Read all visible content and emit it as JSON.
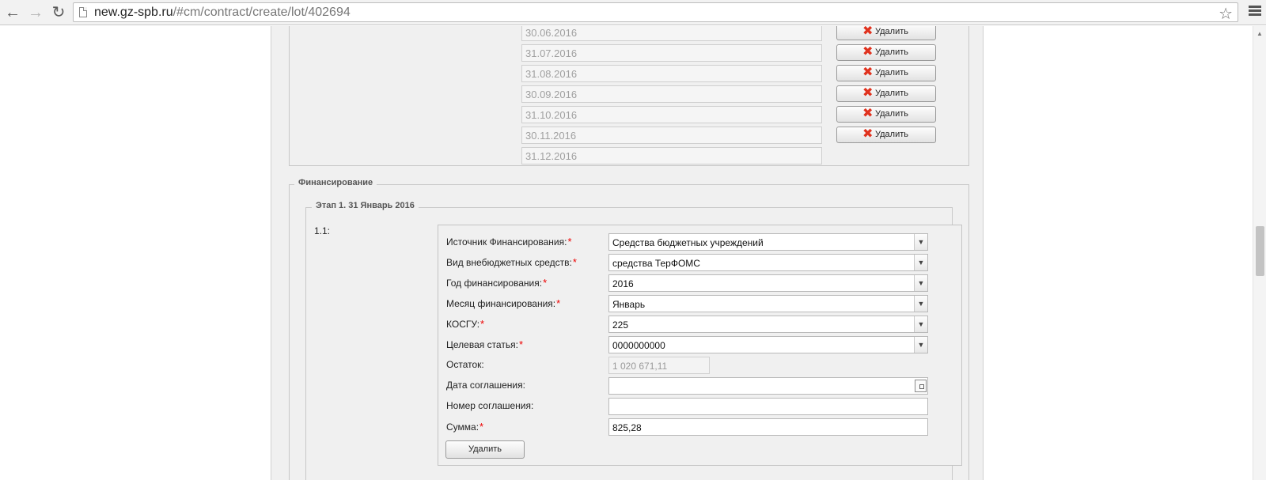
{
  "browser": {
    "url_host": "new.gz-spb.ru",
    "url_path": "/#cm/contract/create/lot/402694"
  },
  "dates": [
    {
      "value": "30.06.2016",
      "delete_label": "Удалить"
    },
    {
      "value": "31.07.2016",
      "delete_label": "Удалить"
    },
    {
      "value": "31.08.2016",
      "delete_label": "Удалить"
    },
    {
      "value": "30.09.2016",
      "delete_label": "Удалить"
    },
    {
      "value": "31.10.2016",
      "delete_label": "Удалить"
    },
    {
      "value": "30.11.2016",
      "delete_label": "Удалить"
    },
    {
      "value": "31.12.2016"
    }
  ],
  "financing": {
    "legend": "Финансирование",
    "stage_legend": "Этап 1. 31 Январь 2016",
    "item_number": "1.1:",
    "fields": {
      "source": {
        "label": "Источник Финансирования:",
        "value": "Средства бюджетных учреждений"
      },
      "offbudget_type": {
        "label": "Вид внебюджетных средств:",
        "value": "средства ТерФОМС"
      },
      "year": {
        "label": "Год финансирования:",
        "value": "2016"
      },
      "month": {
        "label": "Месяц финансирования:",
        "value": "Январь"
      },
      "kosgu": {
        "label": "КОСГУ:",
        "value": "225"
      },
      "target_article": {
        "label": "Целевая статья:",
        "value": "0000000000"
      },
      "remainder": {
        "label": "Остаток:",
        "value": "1 020 671,11"
      },
      "agreement_date": {
        "label": "Дата соглашения:",
        "value": ""
      },
      "agreement_number": {
        "label": "Номер соглашения:",
        "value": ""
      },
      "amount": {
        "label": "Сумма:",
        "value": "825,28"
      }
    },
    "required_mark": "*",
    "delete_label": "Удалить"
  }
}
